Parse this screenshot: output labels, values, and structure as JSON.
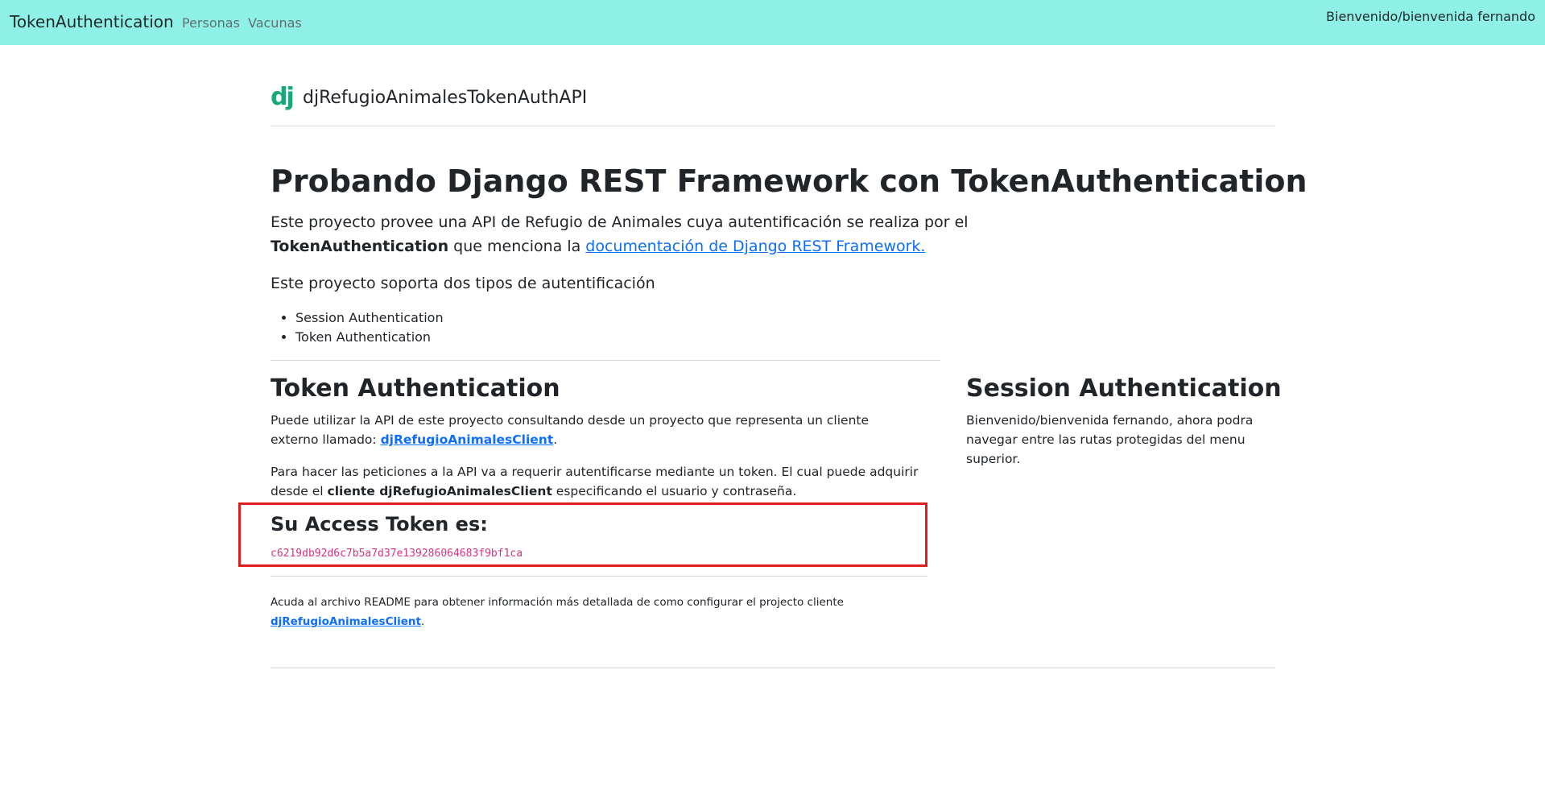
{
  "navbar": {
    "brand": "TokenAuthentication",
    "links": [
      "Personas",
      "Vacunas"
    ],
    "welcome": "Bienvenido/bienvenida fernando",
    "bg_color": "#8ff0e8"
  },
  "header": {
    "logo_text": "dj",
    "site_name": "djRefugioAnimalesTokenAuthAPI",
    "logo_color": "#1aa87a"
  },
  "main": {
    "title": "Probando Django REST Framework con TokenAuthentication",
    "intro_part1": "Este proyecto provee una API de Refugio de Animales cuya autentificación se realiza por el",
    "intro_bold": "TokenAuthentication",
    "intro_part2": " que menciona la ",
    "intro_link": "documentación de Django REST Framework.",
    "support_text": "Este proyecto soporta dos tipos de autentificación",
    "auth_types": [
      "Session Authentication",
      "Token Authentication"
    ]
  },
  "token_section": {
    "title": "Token Authentication",
    "p1_part1": "Puede utilizar la API de este proyecto consultando desde un proyecto que representa un cliente externo llamado: ",
    "p1_link": "djRefugioAnimalesClient",
    "p1_end": ".",
    "p2_part1": "Para hacer las peticiones a la API va a requerir autentificarse mediante un token. El cual puede adquirir desde el ",
    "p2_bold": "cliente djRefugioAnimalesClient",
    "p2_part2": " especificando el usuario y contraseña.",
    "access_title": "Su Access Token es:",
    "token_value": "c6219db92d6c7b5a7d37e139286064683f9bf1ca",
    "note_part1": "Acuda al archivo README para obtener información más detallada de como configurar el projecto cliente ",
    "note_link": "djRefugioAnimalesClient",
    "note_end": ".",
    "highlight_color": "#e01e1e"
  },
  "session_section": {
    "title": "Session Authentication",
    "text": "Bienvenido/bienvenida fernando, ahora podra navegar entre las rutas protegidas del menu superior."
  },
  "colors": {
    "link": "#0d6efd",
    "code": "#d63384"
  }
}
